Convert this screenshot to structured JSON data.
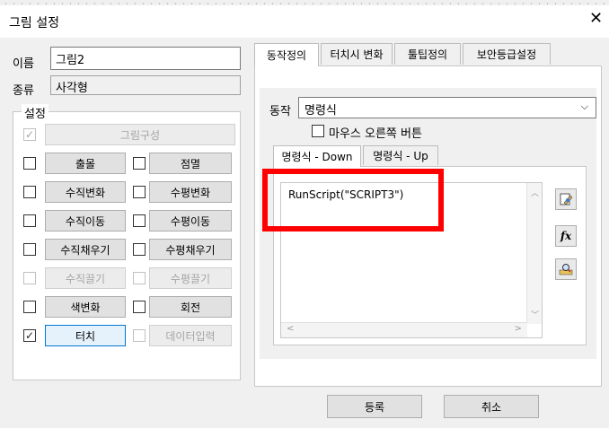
{
  "window": {
    "title": "그림 설정",
    "close_glyph": "✕"
  },
  "fields": {
    "name_label": "이름",
    "name_value": "그림2",
    "type_label": "종류",
    "type_value": "사각형"
  },
  "settings": {
    "group_title": "설정",
    "rows": [
      [
        {
          "label": "그림구성",
          "checked": true,
          "enabled": false,
          "wide": true
        }
      ],
      [
        {
          "label": "출몰",
          "checked": false,
          "enabled": true
        },
        {
          "label": "점멸",
          "checked": false,
          "enabled": true
        }
      ],
      [
        {
          "label": "수직변화",
          "checked": false,
          "enabled": true
        },
        {
          "label": "수평변화",
          "checked": false,
          "enabled": true
        }
      ],
      [
        {
          "label": "수직이동",
          "checked": false,
          "enabled": true
        },
        {
          "label": "수평이동",
          "checked": false,
          "enabled": true
        }
      ],
      [
        {
          "label": "수직채우기",
          "checked": false,
          "enabled": true
        },
        {
          "label": "수평채우기",
          "checked": false,
          "enabled": true
        }
      ],
      [
        {
          "label": "수직끌기",
          "checked": false,
          "enabled": false
        },
        {
          "label": "수평끌기",
          "checked": false,
          "enabled": false
        }
      ],
      [
        {
          "label": "색변화",
          "checked": false,
          "enabled": true
        },
        {
          "label": "회전",
          "checked": false,
          "enabled": true
        }
      ],
      [
        {
          "label": "터치",
          "checked": true,
          "enabled": true,
          "selected": true
        },
        {
          "label": "데이터입력",
          "checked": false,
          "enabled": false
        }
      ]
    ]
  },
  "tabs": [
    "동작정의",
    "터치시 변화",
    "툴팁정의",
    "보안등급설정"
  ],
  "action": {
    "label": "동작",
    "selected": "명령식",
    "right_click_label": "마우스 오른쪽 버튼",
    "subtabs": [
      "명령식 - Down",
      "명령식 - Up"
    ],
    "script": "RunScript(\"SCRIPT3\")"
  },
  "icons": [
    "edit-script-icon",
    "function-fx-icon",
    "lookup-icon"
  ],
  "fx_glyph": "fx",
  "colors": {
    "highlight_box": "#ff0000",
    "selection_border": "#0078d7"
  },
  "buttons": {
    "register": "등록",
    "cancel": "취소"
  }
}
